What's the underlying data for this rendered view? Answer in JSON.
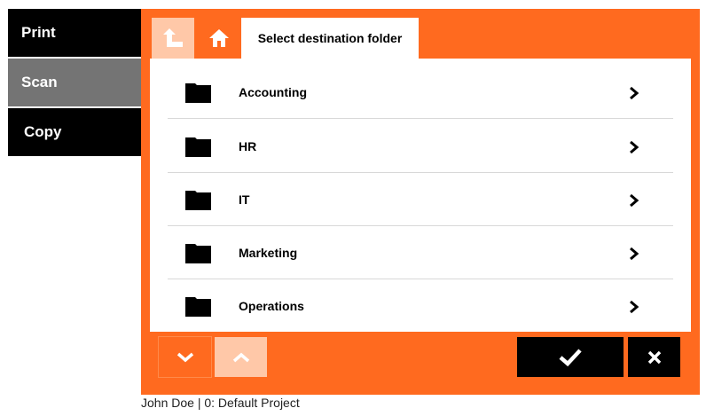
{
  "nav": {
    "print": "Print",
    "scan": "Scan",
    "copy": "Copy"
  },
  "dialog": {
    "title": "Select destination folder",
    "folders": [
      {
        "label": "Accounting"
      },
      {
        "label": "HR"
      },
      {
        "label": "IT"
      },
      {
        "label": "Marketing"
      },
      {
        "label": "Operations"
      }
    ]
  },
  "status": "John Doe | 0: Default Project",
  "colors": {
    "accent": "#ff6a1f",
    "accent_light": "#ffc8a8",
    "selected_nav": "#747474"
  },
  "icons": {
    "up": "folder-up-icon",
    "home": "home-icon",
    "folder": "folder-icon",
    "chevron": "chevron-right-icon",
    "page_down": "chevron-down-icon",
    "page_up": "chevron-up-icon",
    "confirm": "checkmark-icon",
    "cancel": "close-icon"
  }
}
